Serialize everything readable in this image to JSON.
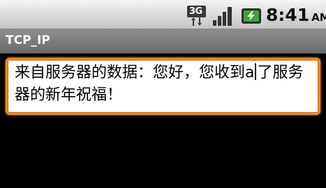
{
  "status_bar": {
    "network_type": "3G",
    "time": "8:41",
    "ampm": "AM",
    "icons": [
      "3g-data-icon",
      "signal-strength-icon",
      "battery-charging-icon"
    ],
    "colors": {
      "battery": "#3fa33a",
      "battery_dark": "#2f2f2f"
    }
  },
  "title_bar": {
    "title": "TCP_IP"
  },
  "message_field": {
    "text_before_cursor": "来自服务器的数据：您好，您收到a",
    "text_after_cursor": "了服务器的新年祝福！",
    "focus_color": "#f08a1c"
  }
}
